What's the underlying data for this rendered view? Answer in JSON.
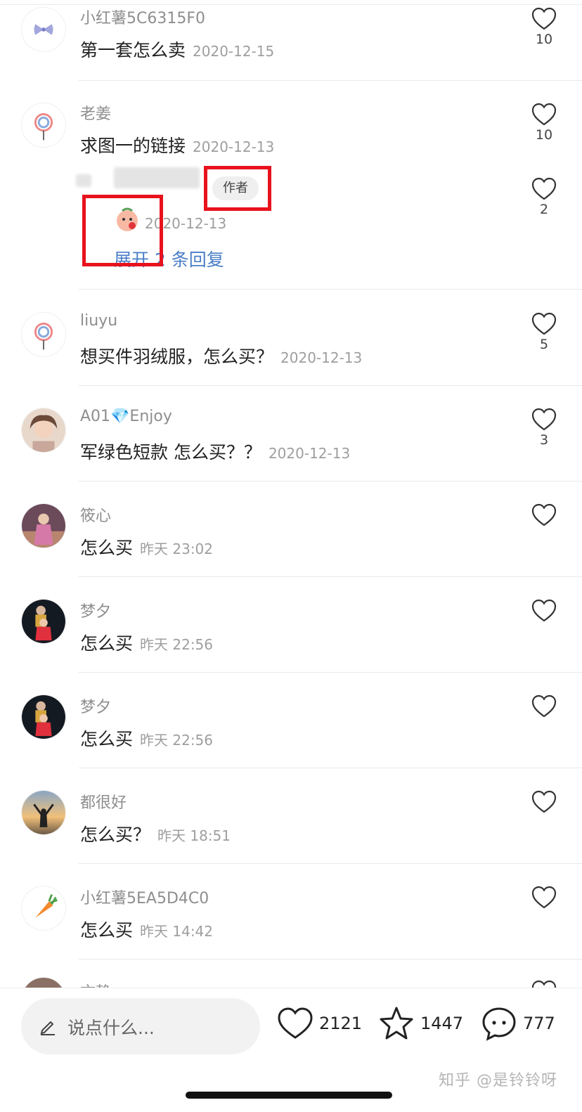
{
  "comments": [
    {
      "username": "小红薯5C6315F0",
      "text": "第一套怎么卖",
      "date": "2020-12-15",
      "likes": "10"
    },
    {
      "username": "老姜",
      "text": "求图一的链接",
      "date": "2020-12-13",
      "likes": "10"
    },
    {
      "username": "liuyu",
      "text": "想买件羽绒服，怎么买？",
      "date": "2020-12-13",
      "likes": "5"
    },
    {
      "username": "A01💎Enjoy",
      "text": "军绿色短款 怎么买？？",
      "date": "2020-12-13",
      "likes": "3"
    },
    {
      "username": "筱心",
      "text": "怎么买",
      "date": "昨天 23:02",
      "likes": ""
    },
    {
      "username": "梦夕",
      "text": "怎么买",
      "date": "昨天 22:56",
      "likes": ""
    },
    {
      "username": "梦夕",
      "text": "怎么买",
      "date": "昨天 22:56",
      "likes": ""
    },
    {
      "username": "都很好",
      "text": "怎么买？",
      "date": "昨天 18:51",
      "likes": ""
    },
    {
      "username": "小红薯5EA5D4C0",
      "text": "怎么买",
      "date": "昨天 14:42",
      "likes": ""
    },
    {
      "username": "文静",
      "text": "",
      "date": "",
      "likes": ""
    }
  ],
  "reply": {
    "author_badge": "作者",
    "date": "2020-12-13",
    "likes": "2",
    "expand_label": "展开 2 条回复"
  },
  "bottom_bar": {
    "input_placeholder": "说点什么...",
    "like_count": "2121",
    "star_count": "1447",
    "comment_count": "777"
  },
  "watermark": "知乎 @是铃铃呀",
  "colors": {
    "highlight": "#e8121d",
    "link": "#4a7ec7"
  }
}
